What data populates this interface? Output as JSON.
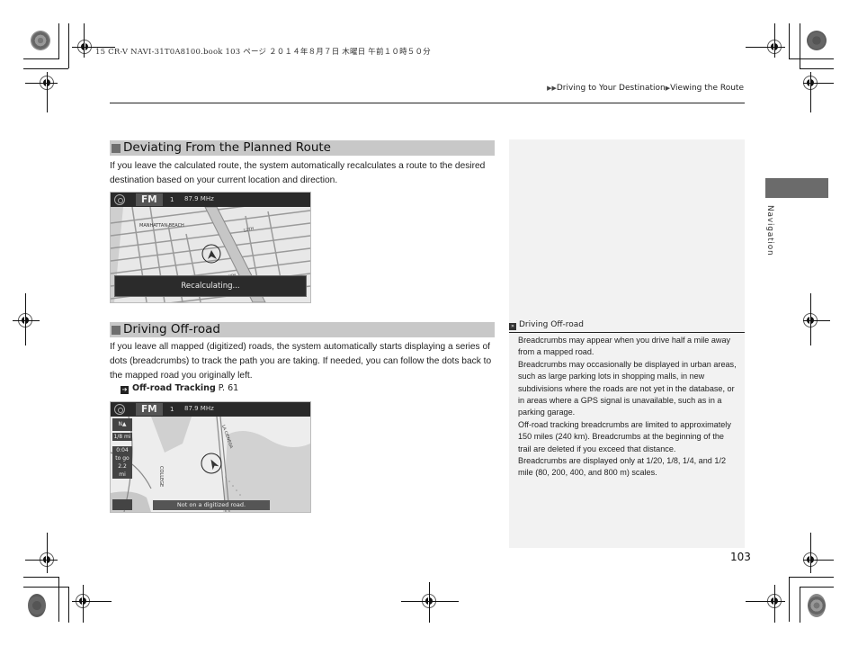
{
  "file_header": "15 CR-V NAVI-31T0A8100.book  103 ページ  ２０１４年８月７日  木曜日  午前１０時５０分",
  "breadcrumb": {
    "items": [
      "Driving to Your Destination",
      "Viewing the Route"
    ]
  },
  "sections": [
    {
      "title": "Deviating From the Planned Route",
      "body": "If you leave the calculated route, the system automatically recalculates a route to the desired destination based on your current location and direction.",
      "screen": {
        "band": "FM",
        "preset": "1",
        "frequency": "87.9 MHz",
        "map_label": "MANHATTAN BEACH",
        "street_labels": [
          "12TH",
          "10TH"
        ],
        "banner": "Recalculating..."
      }
    },
    {
      "title": "Driving Off-road",
      "body": "If you leave all mapped (digitized) roads, the system automatically starts displaying a series of dots (breadcrumbs) to track the path you are taking. If needed, you can follow the dots back to the mapped road you originally left.",
      "xref": {
        "label": "Off-road Tracking",
        "page": "P. 61"
      },
      "screen": {
        "band": "FM",
        "preset": "1",
        "frequency": "87.9 MHz",
        "street_labels": [
          "COLLEGE",
          "LA CIENEGA"
        ],
        "scale": "1/8 mi",
        "time_to_go": "0:04",
        "time_label": "to go",
        "distance": "2.2",
        "distance_unit": "mi",
        "banner": "Not on a digitized road."
      }
    }
  ],
  "note": {
    "title": "Driving Off-road",
    "paragraphs": [
      "Breadcrumbs may appear when you drive half a mile away from a mapped road.",
      "Breadcrumbs may occasionally be displayed in urban areas, such as large parking lots in shopping malls, in new subdivisions where the roads are not yet in the database, or in areas where a GPS signal is unavailable, such as in a parking garage.",
      "Off-road tracking breadcrumbs are limited to approximately 150 miles (240 km). Breadcrumbs at the beginning of the trail are deleted if you exceed that distance.",
      "Breadcrumbs are displayed only at 1/20, 1/8, 1/4, and 1/2 mile (80, 200, 400, and 800 m) scales."
    ]
  },
  "side_tab": {
    "label": "Navigation"
  },
  "page_number": "103"
}
